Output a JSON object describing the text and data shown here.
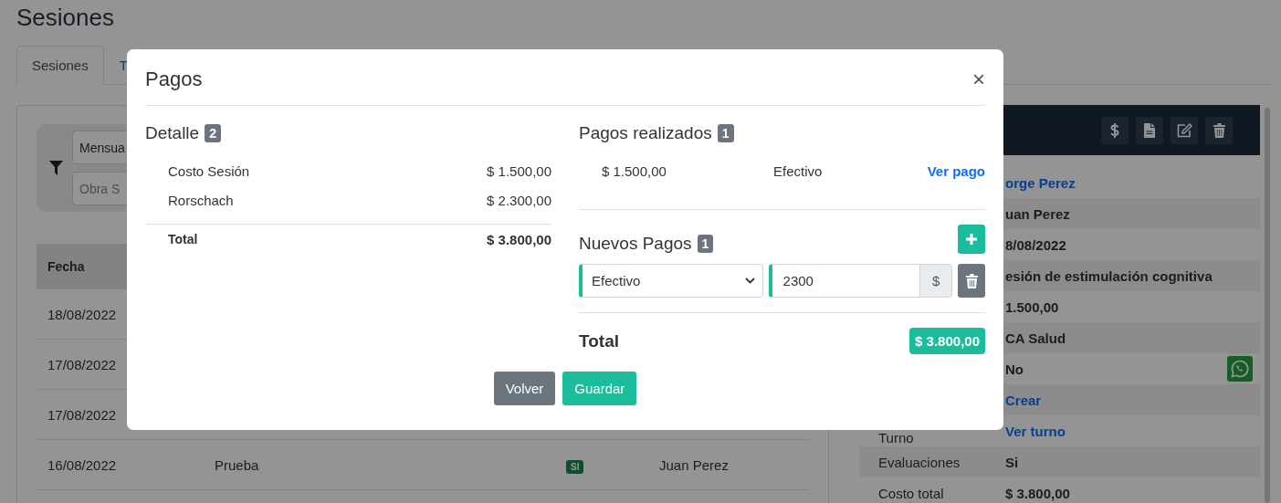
{
  "page": {
    "title": "Sesiones"
  },
  "tabs": [
    {
      "label": "Sesiones",
      "selected": true
    },
    {
      "label": "T",
      "selected": false
    }
  ],
  "filters": {
    "period": {
      "value": "Mensua"
    },
    "insurer": {
      "placeholder": "Obra S"
    }
  },
  "table": {
    "columns": [
      "Fecha"
    ],
    "rows": [
      {
        "date": "18/08/2022"
      },
      {
        "date": "17/08/2022"
      },
      {
        "date": "17/08/2022"
      },
      {
        "date": "16/08/2022",
        "name": "Prueba",
        "badge": "SI",
        "professional": "Juan Perez"
      }
    ]
  },
  "detail_panel": {
    "rows": [
      {
        "value": "orge Perez",
        "kind": "link"
      },
      {
        "value": "uan Perez",
        "kind": "text"
      },
      {
        "value": "8/08/2022",
        "kind": "text"
      },
      {
        "value": "esión de estimulación cognitiva",
        "kind": "text"
      },
      {
        "value": "1.500,00",
        "kind": "text"
      },
      {
        "value": "CA Salud",
        "kind": "text"
      },
      {
        "value": "No",
        "kind": "text",
        "whatsapp": true
      },
      {
        "value": "Crear",
        "kind": "link"
      },
      {
        "label": "Turno",
        "value": "Ver turno",
        "kind": "link"
      },
      {
        "label": "Evaluaciones",
        "value": "Si",
        "kind": "text"
      },
      {
        "label": "Costo total",
        "value": "$ 3.800,00",
        "kind": "text"
      }
    ]
  },
  "modal": {
    "title": "Pagos",
    "close": "×",
    "detail": {
      "title": "Detalle",
      "count": "2",
      "items": [
        {
          "label": "Costo Sesión",
          "amount": "$ 1.500,00"
        },
        {
          "label": "Rorschach",
          "amount": "$ 2.300,00"
        }
      ],
      "total_label": "Total",
      "total": "$ 3.800,00"
    },
    "payments_made": {
      "title": "Pagos realizados",
      "count": "1",
      "items": [
        {
          "amount": "$ 1.500,00",
          "method": "Efectivo",
          "link": "Ver pago"
        }
      ]
    },
    "new_payments": {
      "title": "Nuevos Pagos",
      "count": "1",
      "items": [
        {
          "method": "Efectivo",
          "amount": "2300",
          "currency": "$"
        }
      ]
    },
    "total_label": "Total",
    "total": "$ 3.800,00",
    "buttons": [
      {
        "label": "Volver",
        "kind": "secondary"
      },
      {
        "label": "Guardar",
        "kind": "primary"
      }
    ]
  }
}
